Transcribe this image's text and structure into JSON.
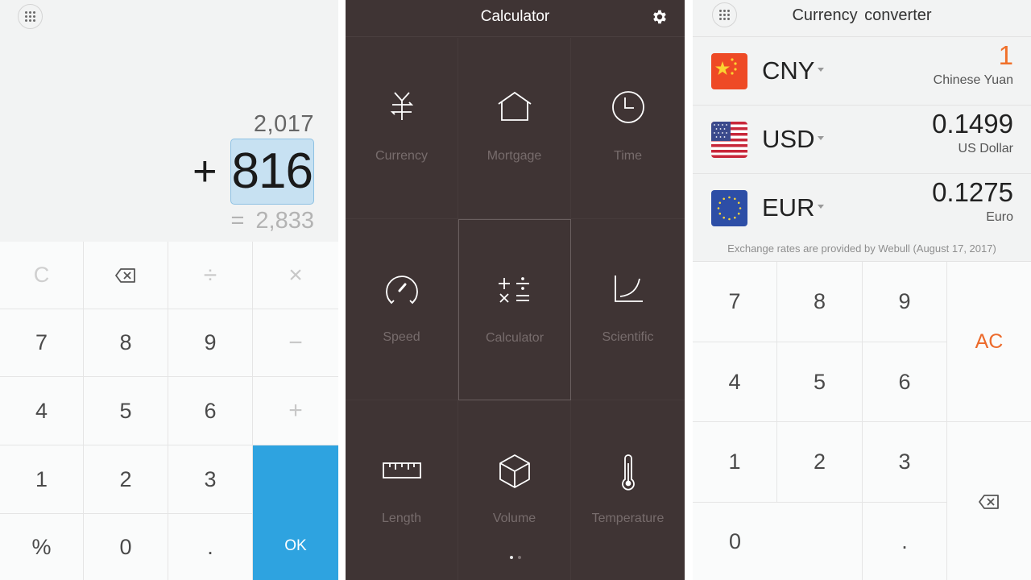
{
  "calculator": {
    "menu_icon": "grid-menu-icon",
    "previous_value": "2,017",
    "operator": "+",
    "current_input": "816",
    "equals_sign": "=",
    "result": "2,833",
    "keys": {
      "clear": "C",
      "backspace": "backspace-icon",
      "divide": "÷",
      "multiply": "×",
      "seven": "7",
      "eight": "8",
      "nine": "9",
      "minus": "−",
      "four": "4",
      "five": "5",
      "six": "6",
      "plus": "+",
      "one": "1",
      "two": "2",
      "three": "3",
      "percent": "%",
      "zero": "0",
      "decimal": ".",
      "ok": "OK"
    },
    "ok_color": "#2ea3e0"
  },
  "tools_menu": {
    "title": "Calculator",
    "settings_icon": "gear-icon",
    "tiles": [
      {
        "label": "Currency",
        "icon": "currency-exchange-icon"
      },
      {
        "label": "Mortgage",
        "icon": "house-icon"
      },
      {
        "label": "Time",
        "icon": "clock-icon"
      },
      {
        "label": "Speed",
        "icon": "speedometer-icon"
      },
      {
        "label": "Calculator",
        "icon": "calculator-operators-icon",
        "selected": true
      },
      {
        "label": "Scientific",
        "icon": "curve-graph-icon"
      },
      {
        "label": "Length",
        "icon": "ruler-icon"
      },
      {
        "label": "Volume",
        "icon": "cube-icon"
      },
      {
        "label": "Temperature",
        "icon": "thermometer-icon"
      }
    ],
    "pager": {
      "pages": 2,
      "current": 1
    },
    "background_color": "#3f3434"
  },
  "currency_converter": {
    "title": "Currency  converter",
    "menu_icon": "grid-menu-icon",
    "currencies": [
      {
        "code": "CNY",
        "name": "Chinese Yuan",
        "amount": "1",
        "flag": "china-flag-icon",
        "active": true
      },
      {
        "code": "USD",
        "name": "US Dollar",
        "amount": "0.1499",
        "flag": "usa-flag-icon",
        "active": false
      },
      {
        "code": "EUR",
        "name": "Euro",
        "amount": "0.1275",
        "flag": "eu-flag-icon",
        "active": false
      }
    ],
    "rate_note": "Exchange rates are provided by Webull (August 17, 2017)",
    "keys": {
      "seven": "7",
      "eight": "8",
      "nine": "9",
      "four": "4",
      "five": "5",
      "six": "6",
      "one": "1",
      "two": "2",
      "three": "3",
      "zero": "0",
      "decimal": ".",
      "all_clear": "AC",
      "backspace": "backspace-icon"
    },
    "accent_color": "#f0702a"
  }
}
